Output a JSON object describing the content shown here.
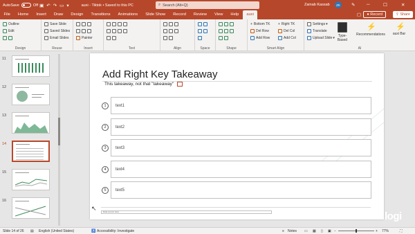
{
  "titlebar": {
    "autosave": "AutoSave",
    "autosave_state": "Off",
    "doc_title": "auxi - Tiktok • Saved to this PC",
    "search_placeholder": "Search (Alt+Q)",
    "user_name": "Zainab Kassab",
    "user_initials": "ZK"
  },
  "menu": {
    "tabs": [
      "File",
      "Home",
      "Insert",
      "Draw",
      "Design",
      "Transitions",
      "Animations",
      "Slide Show",
      "Record",
      "Review",
      "View",
      "Help",
      "auxi"
    ],
    "active_tab": "auxi",
    "record_label": "Record",
    "share_label": "Share"
  },
  "ribbon": {
    "design": {
      "outline": "Outline",
      "edit": "Edit",
      "label": "Design"
    },
    "reuse": {
      "save_slide": "Save Slide",
      "saved_slides": "Saved Slides",
      "email_slides": "Email Slides",
      "label": "Reuse"
    },
    "insert": {
      "painter": "Painter",
      "label": "Insert"
    },
    "text": {
      "label": "Text"
    },
    "align": {
      "label": "Align"
    },
    "space": {
      "label": "Space"
    },
    "shape": {
      "label": "Shape"
    },
    "smart_align": {
      "bottom_tk": "Bottom TK",
      "right_tk": "Right TK",
      "del_row": "Del Row",
      "del_col": "Del Col",
      "add_row": "Add Row",
      "add_col": "Add Col",
      "label": "Smart Align"
    },
    "ai": {
      "settings": "Settings",
      "translate": "Translate",
      "upload_slide": "Upload Slide",
      "type_based": "Type-Based",
      "recommendations": "Recommendations",
      "auxi_bar": "auxi Bar",
      "label": "AI"
    }
  },
  "thumbnails": [
    {
      "num": "11",
      "selected": false
    },
    {
      "num": "12",
      "selected": false
    },
    {
      "num": "13",
      "selected": false
    },
    {
      "num": "14",
      "selected": true
    },
    {
      "num": "15",
      "selected": false
    },
    {
      "num": "16",
      "selected": false
    }
  ],
  "slide": {
    "title": "Add Right Key Takeaway",
    "subtitle": "This takeaway, not that \"takeaway\"",
    "items": [
      {
        "num": "1",
        "text": "text1"
      },
      {
        "num": "2",
        "text": "text2"
      },
      {
        "num": "3",
        "text": "text3"
      },
      {
        "num": "4",
        "text": "text4"
      },
      {
        "num": "5",
        "text": "text5"
      }
    ],
    "source": "Data source here"
  },
  "watermark": "logi",
  "status": {
    "slide_info": "Slide 14 of 26",
    "language": "English (United States)",
    "accessibility": "Accessibility: Investigate",
    "notes": "Notes",
    "zoom": "77%"
  },
  "colors": {
    "accent": "#b7472a",
    "ribbon_bg": "#f3f2f1",
    "workspace": "#e7e6e6"
  }
}
